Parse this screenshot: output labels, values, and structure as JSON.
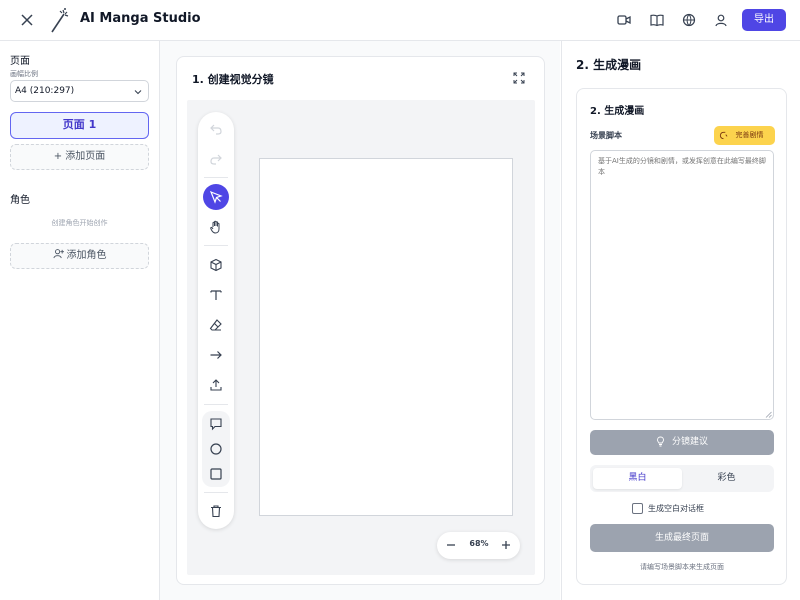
{
  "header": {
    "title": "AI Manga Studio",
    "export_label": "导出",
    "icons": [
      "close-icon",
      "magic-wand-icon",
      "video-icon",
      "book-icon",
      "globe-icon",
      "user-icon"
    ]
  },
  "sidebar": {
    "pages_title": "页面",
    "ratio_label": "画幅比例",
    "ratio_value": "A4 (210:297)",
    "page_item": "页面 1",
    "add_page": "+ 添加页面",
    "characters_title": "角色",
    "characters_hint": "创建角色开始创作",
    "add_character": "添加角色"
  },
  "storyboard": {
    "title": "1. 创建视觉分镜",
    "zoom_value": "68%",
    "tools": [
      "undo-icon",
      "redo-icon",
      "select-cursor-icon",
      "hand-icon",
      "cube-icon",
      "text-icon",
      "eraser-icon",
      "arrow-icon",
      "upload-icon",
      "speech-bubble-icon",
      "circle-icon",
      "square-icon",
      "trash-icon"
    ]
  },
  "generate": {
    "heading": "2. 生成漫画",
    "card_title": "2. 生成漫画",
    "script_label": "场景脚本",
    "refine_label": "完善剧情",
    "script_placeholder": "基于AI生成的分镜和剧情，或发挥创意在此编写最终脚本",
    "suggest_label": "分镜建议",
    "mode_bw": "黑白",
    "mode_color": "彩色",
    "blank_bubbles_label": "生成空白对话框",
    "final_label": "生成最终页面",
    "footer_hint": "请编写场景脚本来生成页面"
  },
  "colors": {
    "accent": "#4f46e5",
    "warning": "#fcd34d",
    "disabled": "#9ca3af"
  }
}
